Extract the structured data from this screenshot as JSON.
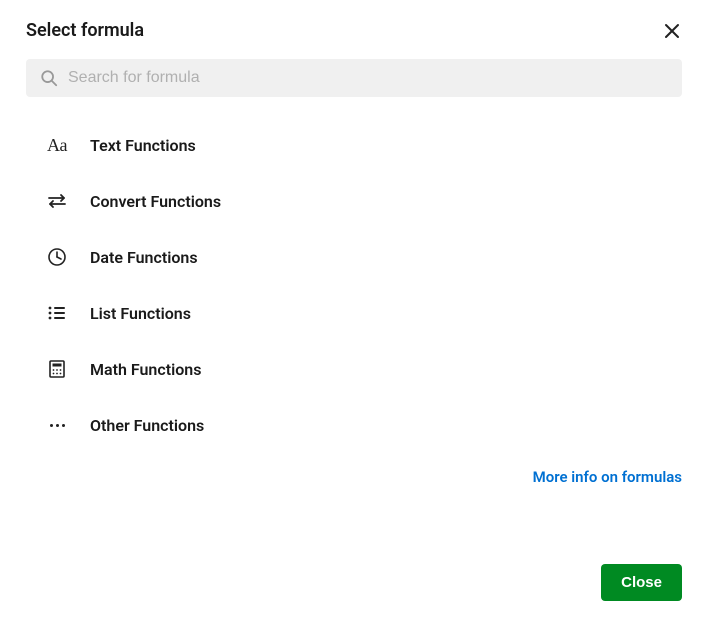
{
  "title": "Select formula",
  "search": {
    "placeholder": "Search for formula"
  },
  "categories": [
    {
      "label": "Text Functions"
    },
    {
      "label": "Convert Functions"
    },
    {
      "label": "Date Functions"
    },
    {
      "label": "List Functions"
    },
    {
      "label": "Math Functions"
    },
    {
      "label": "Other Functions"
    }
  ],
  "more_info": "More info on formulas",
  "close_button": "Close"
}
